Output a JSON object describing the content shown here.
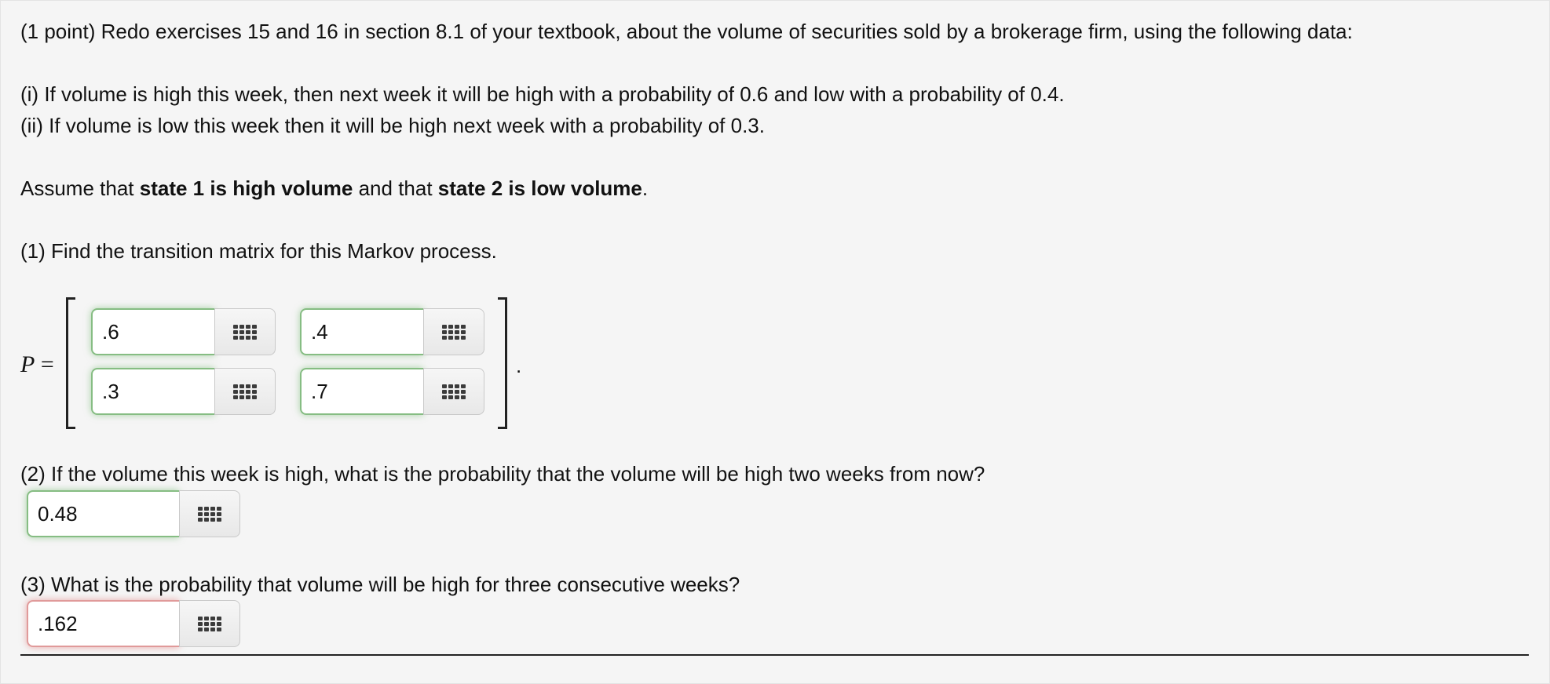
{
  "problem": {
    "intro": "(1 point) Redo exercises 15 and 16 in section 8.1 of your textbook, about the volume of securities sold by a brokerage firm, using the following data:",
    "condition_i": "(i) If volume is high this week, then next week it will be high with a probability of 0.6 and low with a probability of 0.4.",
    "condition_ii": "(ii) If volume is low this week then it will be high next week with a probability of 0.3.",
    "assume": {
      "part1": "Assume that ",
      "state1": "state 1 is high volume",
      "part2": " and that ",
      "state2": "state 2 is low volume",
      "part3": "."
    }
  },
  "q1": {
    "prompt": "(1) Find the transition matrix for this Markov process.",
    "label_var": "P",
    "label_eq": " =",
    "period": ".",
    "matrix": [
      [
        ".6",
        ".4"
      ],
      [
        ".3",
        ".7"
      ]
    ]
  },
  "q2": {
    "prompt": "(2) If the volume this week is high, what is the probability that the volume will be high two weeks from now?",
    "answer": "0.48"
  },
  "q3": {
    "prompt": "(3) What is the probability that volume will be high for three consecutive weeks?",
    "answer": ".162"
  },
  "icons": {
    "palette": "equation-palette-grid-icon"
  },
  "colors": {
    "correct_border": "#86bd83",
    "incorrect_border": "#e09a9a",
    "background": "#f5f5f5"
  }
}
